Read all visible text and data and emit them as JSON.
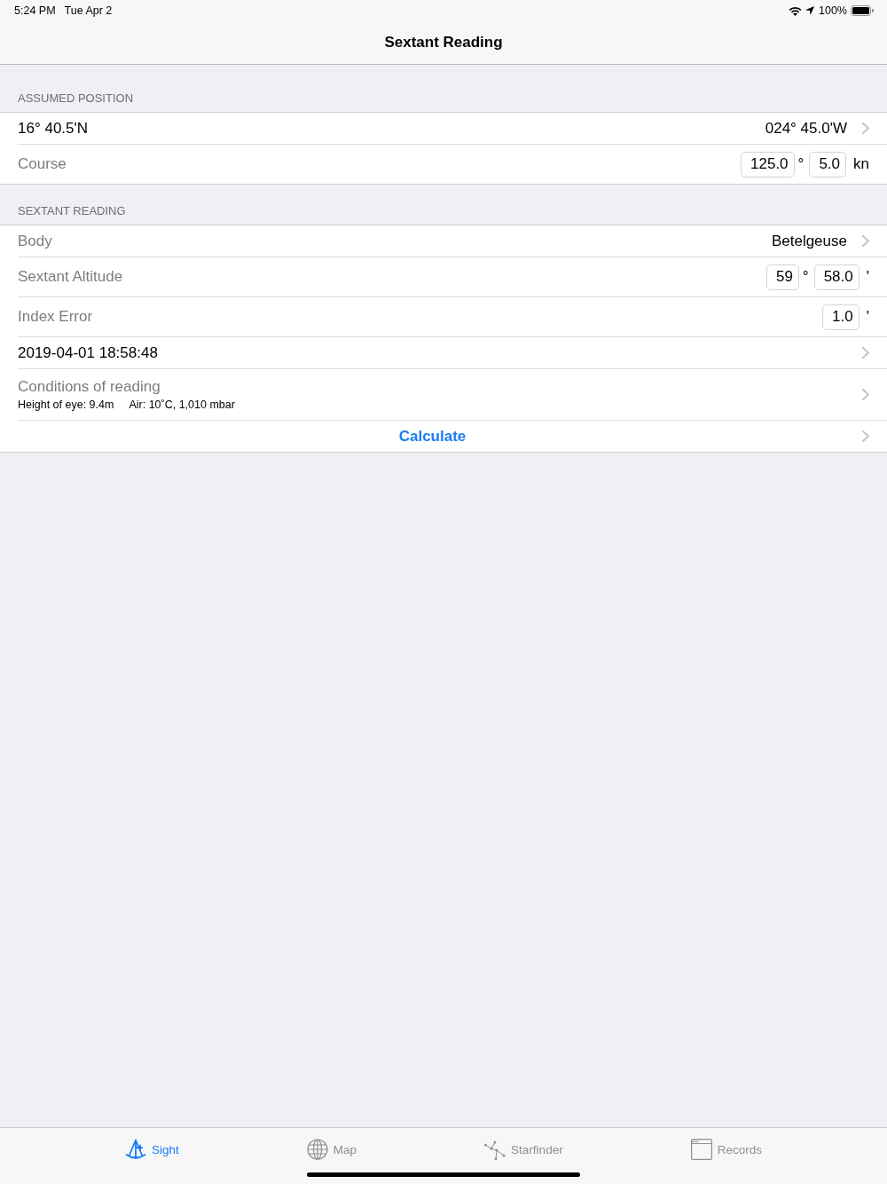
{
  "status_bar": {
    "time": "5:24 PM",
    "date": "Tue Apr 2",
    "battery": "100%"
  },
  "nav_bar": {
    "title": "Sextant Reading"
  },
  "sections": [
    {
      "header": "ASSUMED POSITION",
      "rows": [
        {
          "kind": "position",
          "latitude": "16° 40.5'N",
          "longitude": "024° 45.0'W",
          "disclosure": true
        },
        {
          "kind": "fields",
          "label": "Course",
          "fields": [
            {
              "value": "125.0",
              "unit": "°"
            },
            {
              "value": "5.0",
              "unit": "kn"
            }
          ],
          "disclosure": false
        }
      ]
    },
    {
      "header": "SEXTANT READING",
      "rows": [
        {
          "kind": "detail",
          "label": "Body",
          "value": "Betelgeuse",
          "disclosure": true
        },
        {
          "kind": "fields",
          "label": "Sextant Altitude",
          "fields": [
            {
              "value": "59",
              "unit": "°"
            },
            {
              "value": "58.0",
              "unit": "'"
            }
          ],
          "disclosure": false
        },
        {
          "kind": "fields",
          "label": "Index Error",
          "fields": [
            {
              "value": "1.0",
              "unit": "'"
            }
          ],
          "disclosure": false
        },
        {
          "kind": "value",
          "value": "2019-04-01 18:58:48",
          "disclosure": true
        },
        {
          "kind": "subtitle",
          "label": "Conditions of reading",
          "details": [
            "Height of eye: 9.4m",
            "Air: 10˚C, 1,010 mbar"
          ],
          "disclosure": true
        },
        {
          "kind": "action",
          "label": "Calculate",
          "disclosure": true
        }
      ]
    }
  ],
  "tab_bar": {
    "items": [
      {
        "label": "Sight",
        "selected": true
      },
      {
        "label": "Map",
        "selected": false
      },
      {
        "label": "Starfinder",
        "selected": false
      },
      {
        "label": "Records",
        "selected": false
      }
    ]
  }
}
